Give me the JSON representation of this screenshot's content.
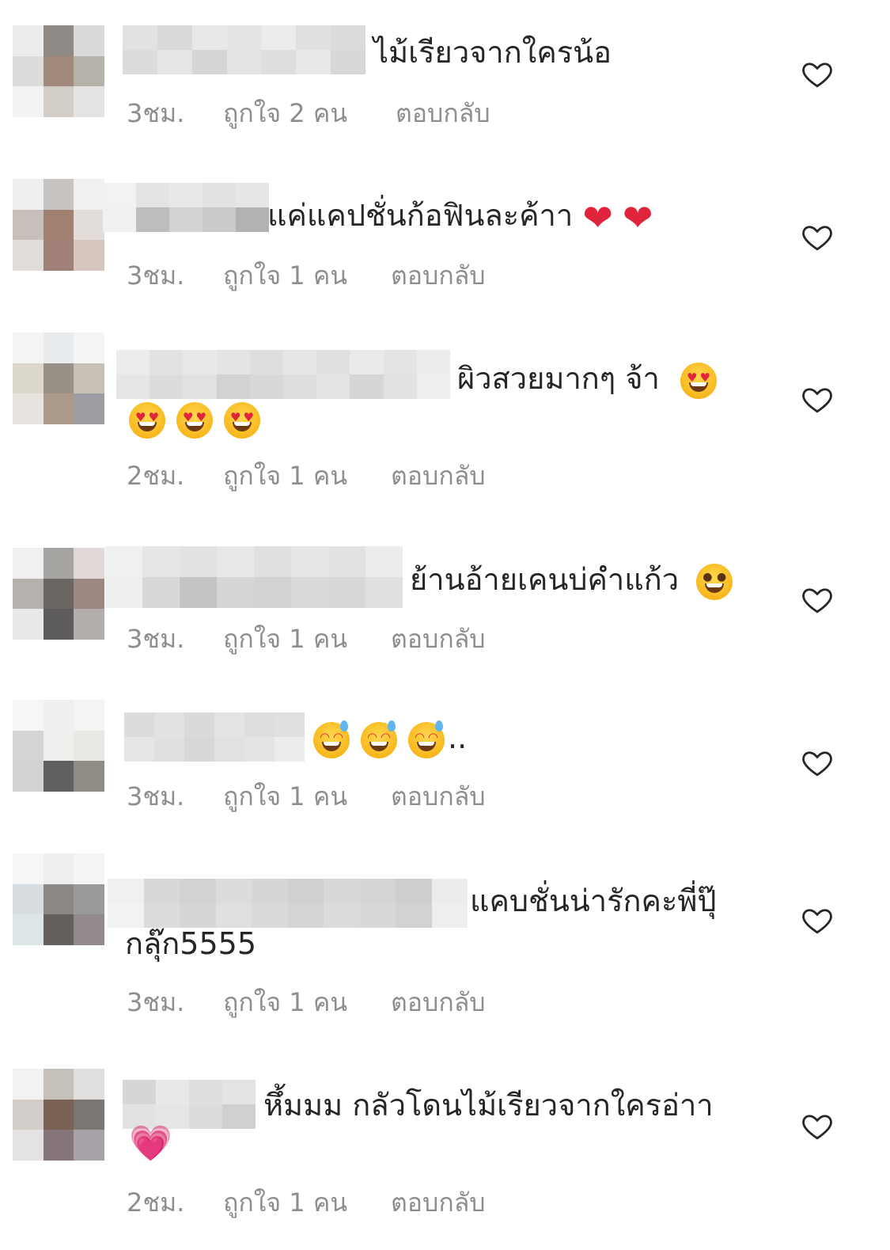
{
  "comments": [
    {
      "text": "ไม้เรียวจากใครน้อ",
      "time": "3ชม.",
      "likes": "ถูกใจ 2 คน",
      "reply": "ตอบกลับ"
    },
    {
      "text": "แค่แคปชั่นก้อฟินละค้าา",
      "time": "3ชม.",
      "likes": "ถูกใจ 1 คน",
      "reply": "ตอบกลับ"
    },
    {
      "text": "ผิวสวยมากๆ จ้า",
      "time": "2ชม.",
      "likes": "ถูกใจ 1 คน",
      "reply": "ตอบกลับ"
    },
    {
      "text": "ย้านอ้ายเคนบ่คำแก้ว",
      "time": "3ชม.",
      "likes": "ถูกใจ 1 คน",
      "reply": "ตอบกลับ"
    },
    {
      "text": "..",
      "time": "3ชม.",
      "likes": "ถูกใจ 1 คน",
      "reply": "ตอบกลับ"
    },
    {
      "text": "แคบชั่นน่ารักคะพี่ปุ๊",
      "text_line2": "กลุ๊ก5555",
      "time": "3ชม.",
      "likes": "ถูกใจ 1 คน",
      "reply": "ตอบกลับ"
    },
    {
      "text": "หึ้มมม กลัวโดนไม้เรียวจากใครอ่าา",
      "time": "2ชม.",
      "likes": "ถูกใจ 1 คน",
      "reply": "ตอบกลับ"
    }
  ],
  "icons": {
    "like": "heart-outline-icon",
    "red_heart": "red-heart-emoji",
    "heart_eyes": "heart-eyes-emoji",
    "smiley": "smiley-emoji",
    "sweat_smile": "sweat-smile-emoji",
    "growing_heart": "growing-heart-emoji"
  },
  "colors": {
    "text": "#262626",
    "meta": "#8e8e8e",
    "like_icon": "#262626"
  }
}
